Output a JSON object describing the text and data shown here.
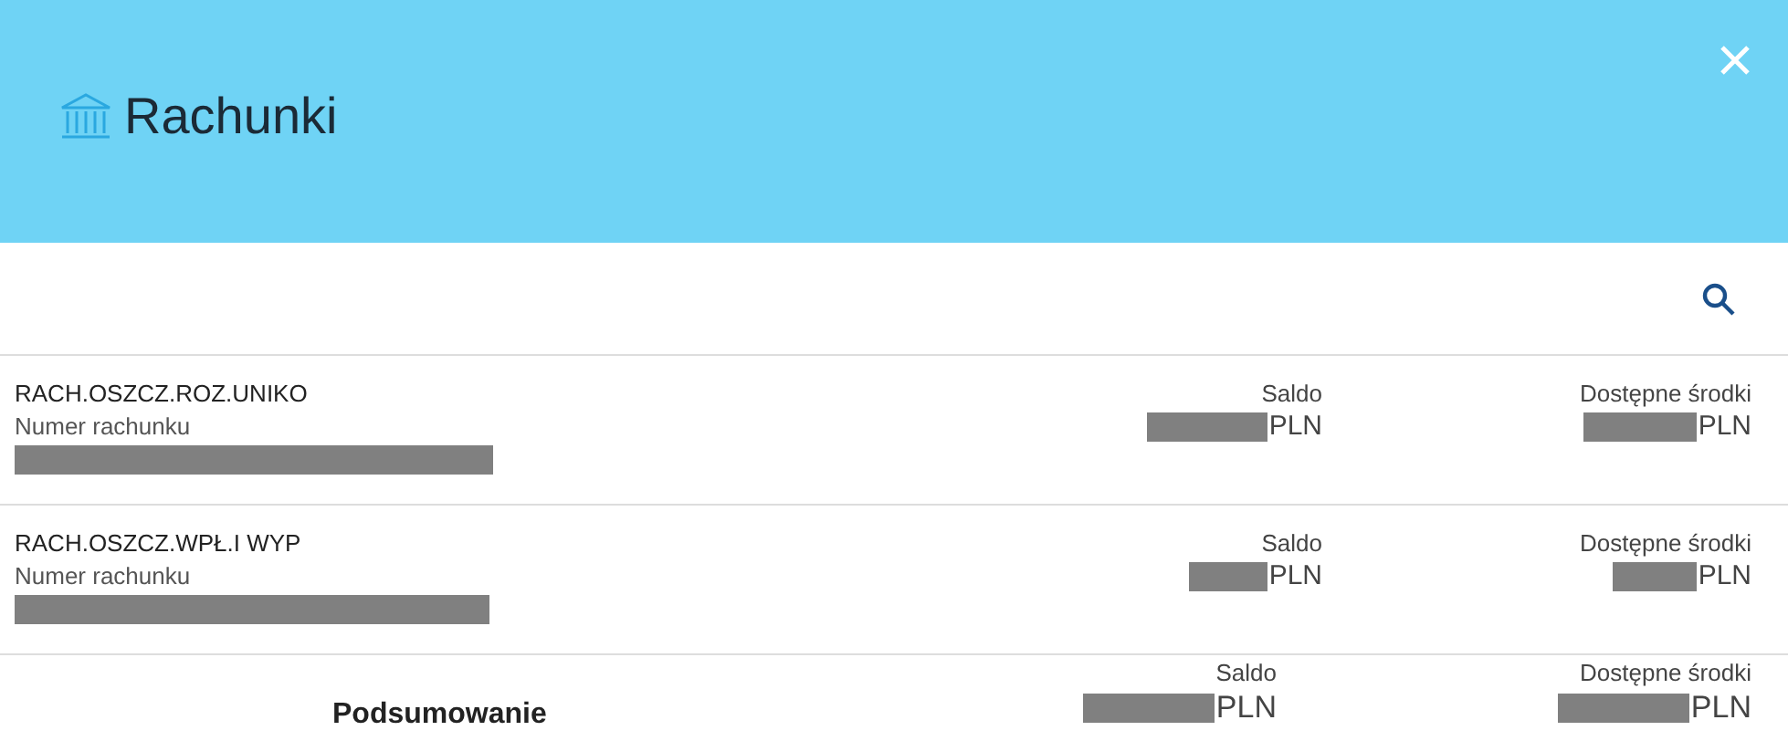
{
  "header": {
    "title": "Rachunki"
  },
  "accounts": [
    {
      "name": "RACH.OSZCZ.ROZ.UNIKO",
      "number_label": "Numer rachunku",
      "balance_label": "Saldo",
      "balance_currency": "PLN",
      "available_label": "Dostępne środki",
      "available_currency": "PLN"
    },
    {
      "name": "RACH.OSZCZ.WPŁ.I WYP",
      "number_label": "Numer rachunku",
      "balance_label": "Saldo",
      "balance_currency": "PLN",
      "available_label": "Dostępne środki",
      "available_currency": "PLN"
    }
  ],
  "summary": {
    "title": "Podsumowanie",
    "balance_label": "Saldo",
    "balance_currency": "PLN",
    "available_label": "Dostępne środki",
    "available_currency": "PLN"
  }
}
